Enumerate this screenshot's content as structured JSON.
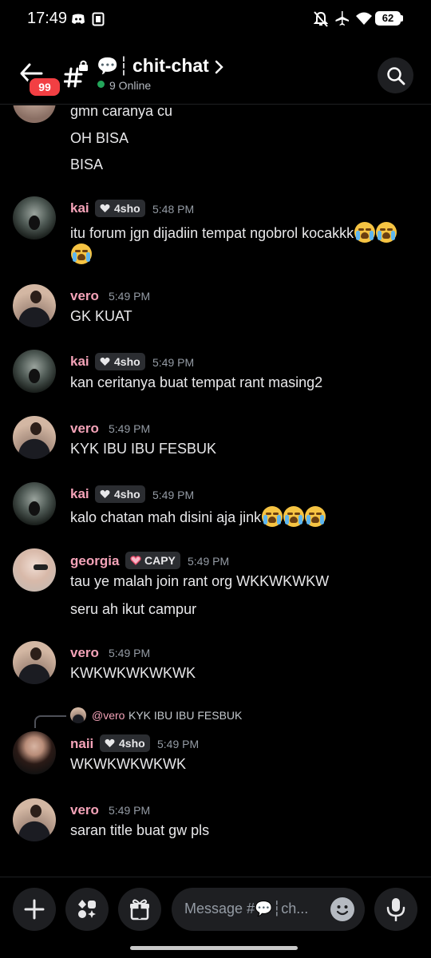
{
  "status_bar": {
    "time": "17:49",
    "battery": "62",
    "icons": [
      "discord-icon",
      "screenshot-icon",
      "mute-icon",
      "airplane-icon",
      "wifi-icon",
      "battery-icon"
    ]
  },
  "header": {
    "badge_count": "99",
    "channel_name": "chit-chat",
    "channel_prefix": "💬┆",
    "online_text": "9 Online",
    "icons": [
      "back-arrow-icon",
      "locked-hashtag-icon",
      "chevron-right-icon",
      "search-icon"
    ]
  },
  "messages": [
    {
      "id": "m0",
      "lines": [
        "gmn caranya cu",
        "OH BISA",
        "BISA"
      ]
    },
    {
      "id": "m1",
      "user": "kai",
      "tag": "4sho",
      "time": "5:48 PM",
      "text": "itu forum jgn dijadiin tempat ngobrol kocakkk",
      "emoji_count_line1": 2,
      "emoji_count_line2": 1
    },
    {
      "id": "m2",
      "user": "vero",
      "time": "5:49 PM",
      "text": "GK KUAT"
    },
    {
      "id": "m3",
      "user": "kai",
      "tag": "4sho",
      "time": "5:49 PM",
      "text": "kan ceritanya buat tempat rant masing2"
    },
    {
      "id": "m4",
      "user": "vero",
      "time": "5:49 PM",
      "text": "KYK IBU IBU FESBUK"
    },
    {
      "id": "m5",
      "user": "kai",
      "tag": "4sho",
      "time": "5:49 PM",
      "text": "kalo chatan mah disini aja jink",
      "emoji_count": 3
    },
    {
      "id": "m6",
      "user": "georgia",
      "tag": "CAPY",
      "time": "5:49 PM",
      "lines": [
        "tau ye malah join rant org WKKWKWKW",
        "seru ah ikut campur"
      ]
    },
    {
      "id": "m7",
      "user": "vero",
      "time": "5:49 PM",
      "text": "KWKWKWKWKWK"
    },
    {
      "id": "m8",
      "user": "naii",
      "tag": "4sho",
      "time": "5:49 PM",
      "text": "WKWKWKWKWK",
      "reply": {
        "user": "@vero",
        "text": "KYK IBU IBU FESBUK"
      }
    },
    {
      "id": "m9",
      "user": "vero",
      "time": "5:49 PM",
      "text": "saran title buat gw pls"
    }
  ],
  "composer": {
    "placeholder": "Message #💬┆ch...",
    "icons": [
      "plus-icon",
      "apps-icon",
      "gift-icon",
      "emoji-icon",
      "microphone-icon"
    ]
  },
  "colors": {
    "background": "#000000",
    "username": "#f4a3b8",
    "timestamp": "#949ba4",
    "badge": "#f23f43",
    "online": "#23a55a",
    "surface": "#1e1f22"
  }
}
